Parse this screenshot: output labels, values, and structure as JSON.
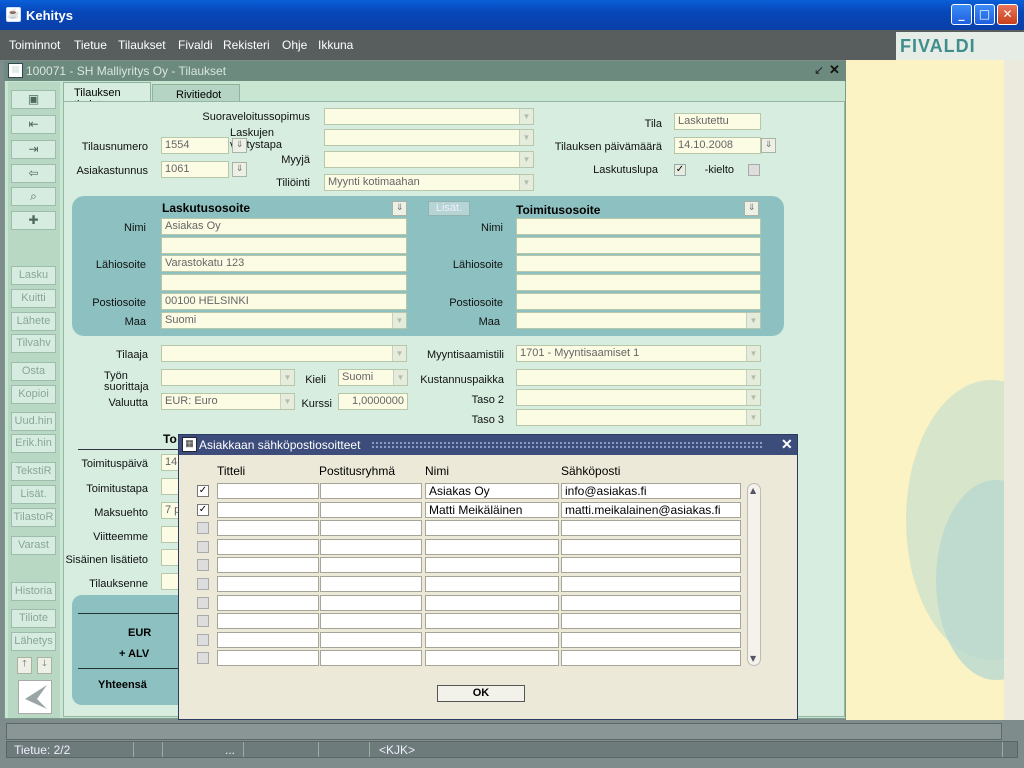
{
  "window": {
    "title": "Kehitys"
  },
  "menu": [
    "Toiminnot",
    "Tietue",
    "Tilaukset",
    "Fivaldi",
    "Rekisteri",
    "Ohje",
    "Ikkuna"
  ],
  "brand": "FIVALDI",
  "inner_window": {
    "title": "100071 - SH Malliyritys Oy - Tilaukset"
  },
  "toolbar": {
    "labels": [
      "Lasku",
      "Kuitti",
      "Lähete",
      "Tilvahv",
      "Osta",
      "Kopioi",
      "Uud.hin",
      "Erik.hin",
      "TekstiR",
      "Lisät.",
      "TilastoR",
      "Varast",
      "Historia",
      "Tiliote",
      "Lähetys"
    ]
  },
  "tabs": [
    "Tilauksen tiedot",
    "Rivitiedot"
  ],
  "form": {
    "suoraveloitus_label": "Suoraveloitussopimus",
    "laskujen_label": "Laskujen välitystapa",
    "myyja_label": "Myyjä",
    "tiliointi_label": "Tiliöinti",
    "tiliointi_value": "Myynti kotimaahan",
    "tilausnumero_label": "Tilausnumero",
    "tilausnumero_value": "1554",
    "asiakastunnus_label": "Asiakastunnus",
    "asiakastunnus_value": "1061",
    "tila_label": "Tila",
    "tila_value": "Laskutettu",
    "paivamaara_label": "Tilauksen päivämäärä",
    "paivamaara_value": "14.10.2008",
    "laskutuslupa_label": "Laskutuslupa",
    "kielto_label": "-kielto"
  },
  "billing": {
    "header": "Laskutusosoite",
    "nimi_label": "Nimi",
    "nimi_value": "Asiakas Oy",
    "lahiosoite_label": "Lähiosoite",
    "lahiosoite_value": "Varastokatu 123",
    "postiosoite_label": "Postiosoite",
    "postiosoite_value": "00100  HELSINKI",
    "maa_label": "Maa",
    "maa_value": "Suomi"
  },
  "lisat_button": "Lisät.",
  "delivery": {
    "header": "Toimitusosoite",
    "nimi_label": "Nimi",
    "lahiosoite_label": "Lähiosoite",
    "postiosoite_label": "Postiosoite",
    "maa_label": "Maa"
  },
  "lower": {
    "tilaaja_label": "Tilaaja",
    "tyon_label": "Työn suorittaja",
    "kieli_label": "Kieli",
    "kieli_value": "Suomi",
    "valuutta_label": "Valuutta",
    "valuutta_value": "EUR: Euro",
    "kurssi_label": "Kurssi",
    "kurssi_value": "1,0000000",
    "myyntisaamistili_label": "Myyntisaamistili",
    "myyntisaamistili_value": "1701 - Myyntisaamiset 1",
    "kustannuspaikka_label": "Kustannuspaikka",
    "taso2_label": "Taso 2",
    "taso3_label": "Taso 3",
    "to_header": "To",
    "toimituspaiva_label": "Toimituspäivä",
    "toimituspaiva_value": "14",
    "toimitustapa_label": "Toimitustapa",
    "maksuehto_label": "Maksuehto",
    "maksuehto_value": "7 p",
    "viitteemme_label": "Viitteemme",
    "sisainen_label": "Sisäinen lisätieto",
    "tilauksenne_label": "Tilauksenne",
    "eur_label": "EUR",
    "alv_label": "+ ALV",
    "yhteensa_label": "Yhteensä"
  },
  "modal": {
    "title": "Asiakkaan sähköpostiosoitteet",
    "columns": [
      "Titteli",
      "Postitusryhmä",
      "Nimi",
      "Sähköposti"
    ],
    "rows": [
      {
        "checked": true,
        "titteli": "",
        "ryhma": "",
        "nimi": "Asiakas Oy",
        "email": "info@asiakas.fi"
      },
      {
        "checked": true,
        "titteli": "",
        "ryhma": "",
        "nimi": "Matti Meikäläinen",
        "email": "matti.meikalainen@asiakas.fi"
      },
      {
        "checked": false,
        "titteli": "",
        "ryhma": "",
        "nimi": "",
        "email": ""
      },
      {
        "checked": false,
        "titteli": "",
        "ryhma": "",
        "nimi": "",
        "email": ""
      },
      {
        "checked": false,
        "titteli": "",
        "ryhma": "",
        "nimi": "",
        "email": ""
      },
      {
        "checked": false,
        "titteli": "",
        "ryhma": "",
        "nimi": "",
        "email": ""
      },
      {
        "checked": false,
        "titteli": "",
        "ryhma": "",
        "nimi": "",
        "email": ""
      },
      {
        "checked": false,
        "titteli": "",
        "ryhma": "",
        "nimi": "",
        "email": ""
      },
      {
        "checked": false,
        "titteli": "",
        "ryhma": "",
        "nimi": "",
        "email": ""
      },
      {
        "checked": false,
        "titteli": "",
        "ryhma": "",
        "nimi": "",
        "email": ""
      }
    ],
    "ok_label": "OK"
  },
  "status": {
    "record": "Tietue: 2/2",
    "dots": "...",
    "kbd": "<KJK>"
  }
}
